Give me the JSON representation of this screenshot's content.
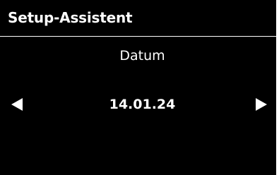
{
  "header": {
    "title": "Setup-Assistent"
  },
  "field": {
    "label": "Datum",
    "value": "14.01.24"
  },
  "controls": {
    "previous_icon": "triangle-left-icon",
    "next_icon": "triangle-right-icon"
  },
  "colors": {
    "background": "#000000",
    "foreground": "#ffffff"
  }
}
